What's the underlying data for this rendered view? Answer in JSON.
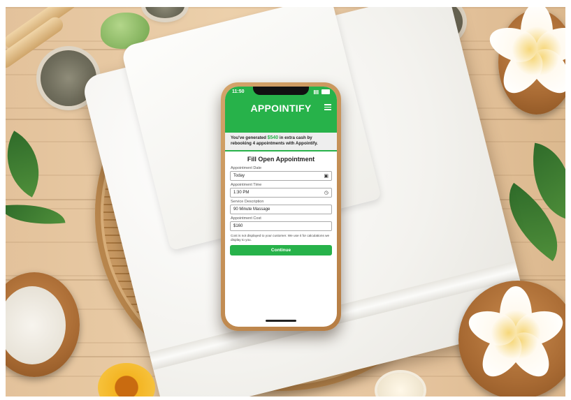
{
  "app": {
    "status_time": "11:50",
    "logo": "APPOINTIFY",
    "banner": {
      "prefix": "You've generated ",
      "amount": "$540",
      "suffix": " in extra cash by rebooking 4 appointments with Appointify."
    },
    "form": {
      "title": "Fill Open Appointment",
      "fields": [
        {
          "label": "Appointment Date",
          "value": "Today",
          "icon": "calendar-icon"
        },
        {
          "label": "Appointment Time",
          "value": "1:30 PM",
          "icon": "clock-icon"
        },
        {
          "label": "Service Description",
          "value": "90 Minute Massage"
        },
        {
          "label": "Appointment Cost",
          "value": "$160"
        }
      ],
      "note": "Cost is not displayed to your customer. We use it for calculations we display to you.",
      "continue_label": "Continue"
    }
  },
  "colors": {
    "brand_green": "#27b24a"
  }
}
